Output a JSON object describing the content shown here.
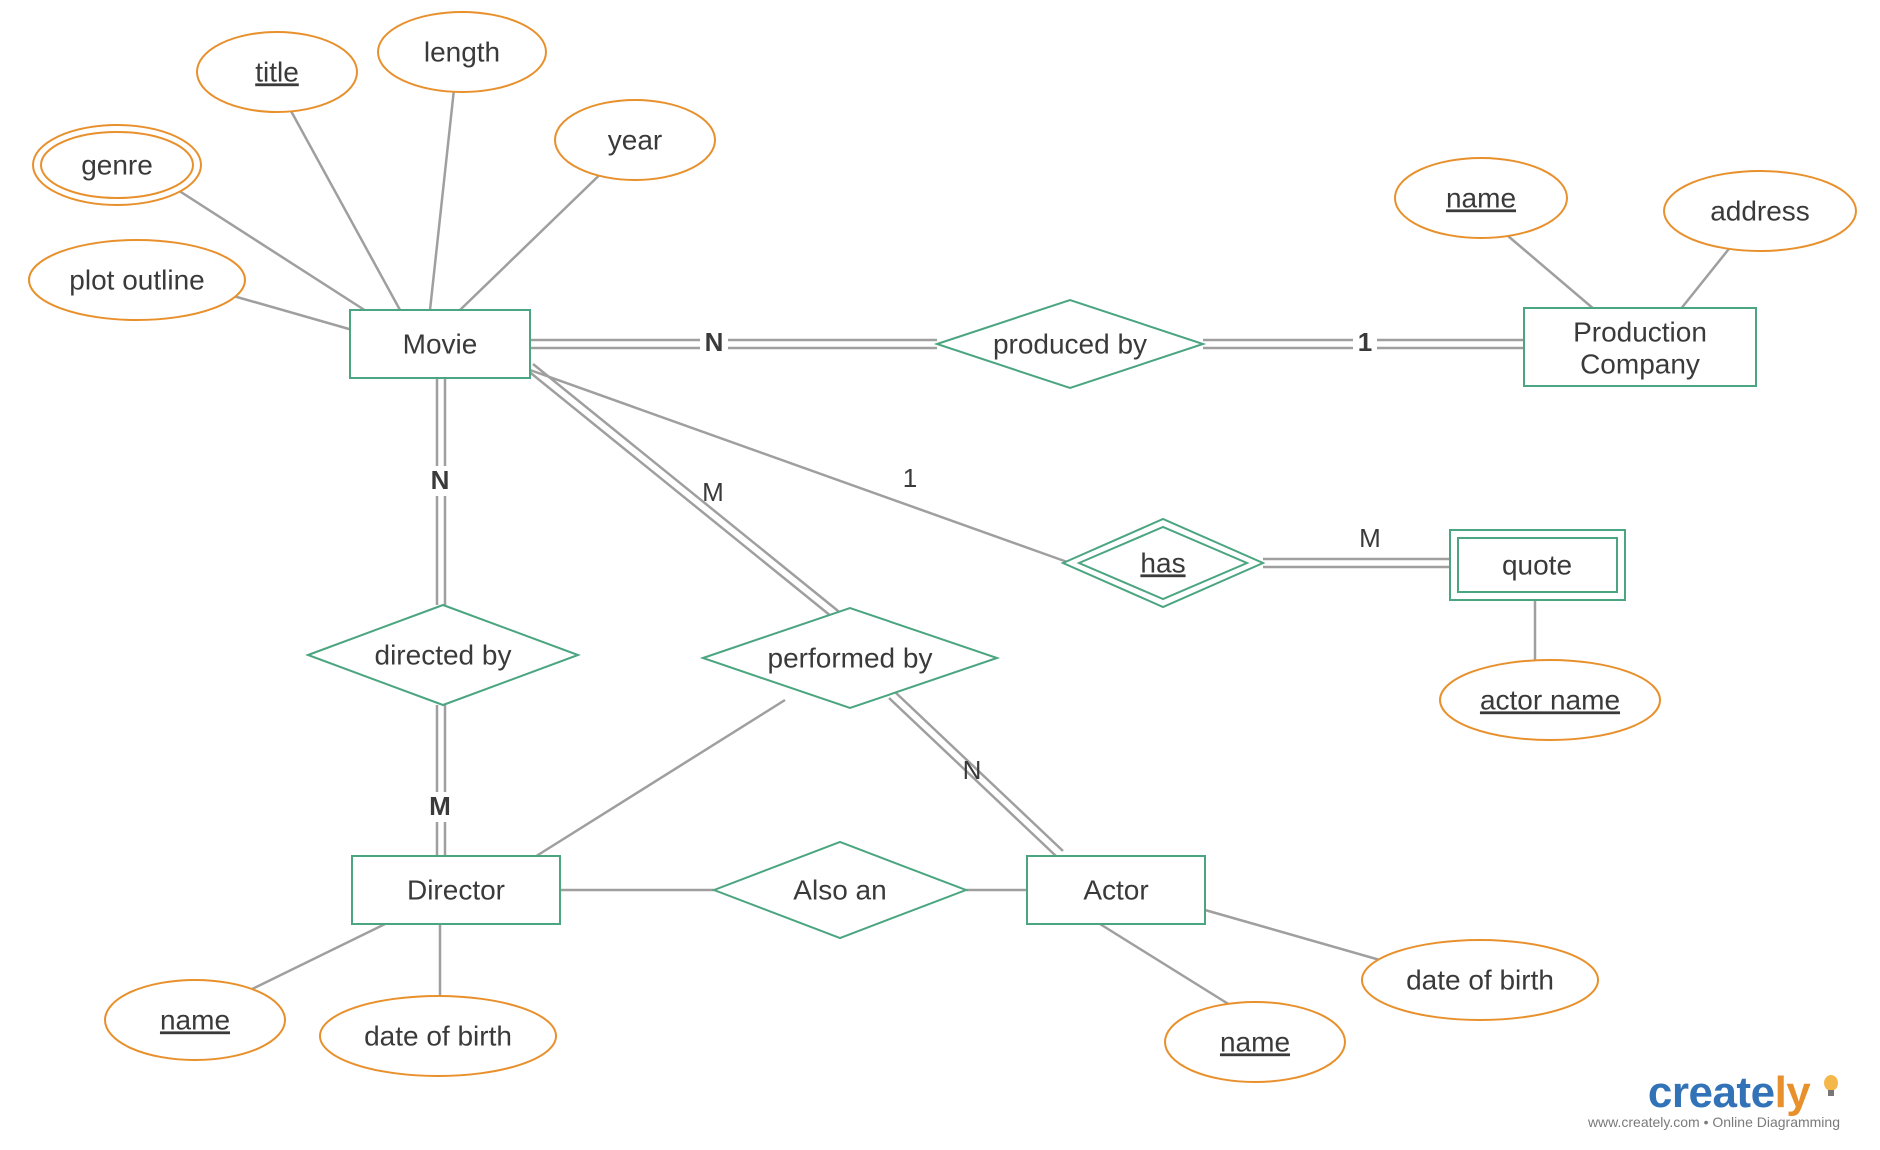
{
  "entities": {
    "movie": {
      "label": "Movie"
    },
    "production_company": {
      "line1": "Production",
      "line2": "Company"
    },
    "director": {
      "label": "Director"
    },
    "actor": {
      "label": "Actor"
    },
    "quote": {
      "label": "quote",
      "weak": true
    }
  },
  "attributes": {
    "movie": {
      "genre": {
        "label": "genre",
        "multivalued": true
      },
      "title": {
        "label": "title",
        "key": true
      },
      "length": {
        "label": "length"
      },
      "year": {
        "label": "year"
      },
      "plot_outline": {
        "label": "plot outline"
      }
    },
    "production_company": {
      "name": {
        "label": "name",
        "key": true
      },
      "address": {
        "label": "address"
      }
    },
    "director": {
      "name": {
        "label": "name",
        "key": true
      },
      "dob": {
        "label": "date of birth"
      }
    },
    "actor": {
      "name": {
        "label": "name",
        "key": true
      },
      "dob": {
        "label": "date of birth"
      }
    },
    "quote": {
      "actor_name": {
        "label": "actor name",
        "key": true
      }
    }
  },
  "relationships": {
    "produced_by": {
      "label": "produced by",
      "card_left": "N",
      "card_right": "1"
    },
    "directed_by": {
      "label": "directed by",
      "card_top": "N",
      "card_bottom": "M"
    },
    "performed_by": {
      "label": "performed by",
      "card_top": "M",
      "card_bottom": "N"
    },
    "has": {
      "label": "has",
      "card_left": "1",
      "card_right": "M",
      "identifying": true
    },
    "also_an": {
      "label": "Also an"
    }
  },
  "watermark": {
    "brand_prefix": "create",
    "brand_suffix": "ly",
    "tagline": "www.creately.com • Online Diagramming"
  }
}
